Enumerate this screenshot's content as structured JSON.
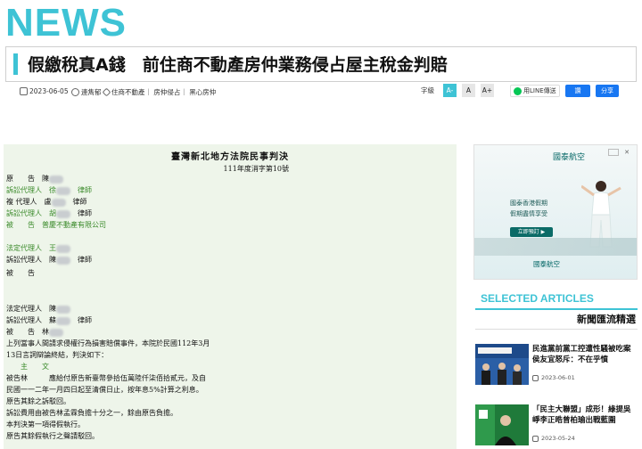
{
  "logo": "NEWS",
  "headline": "假繳稅真A錢　前住商不動產房仲業務侵占屋主稅金判賠",
  "meta": {
    "date": "2023-06-05",
    "author": "連雋郁",
    "tags": "住商不動產｜ 房仲侵占｜ 黑心房仲"
  },
  "font_control": {
    "label": "字級",
    "sizes": [
      "A-",
      "A",
      "A+"
    ]
  },
  "share": {
    "line": "用LINE傳送",
    "like": "讚",
    "fb": "分享"
  },
  "document": {
    "title": "臺灣新北地方法院民事判決",
    "case_no": "111年度消字第10號",
    "lines": [
      [
        "原　　告　陳",
        "",
        ""
      ],
      [
        "訴訟代理人　徐",
        "",
        "　律師"
      ],
      [
        "複 代理人　盧",
        "",
        "　律師"
      ],
      [
        "訴訟代理人　胡",
        "",
        "　律師"
      ],
      [
        "被　　告　普慶不動產有限公司",
        "",
        ""
      ],
      [
        "法定代理人　王",
        "",
        ""
      ],
      [
        "訴訟代理人　陳",
        "",
        "　律師"
      ],
      [
        "被　　告",
        "",
        ""
      ],
      [
        "法定代理人　陳",
        "",
        ""
      ],
      [
        "訴訟代理人　蘇",
        "",
        "　律師"
      ],
      [
        "被　　告　林",
        "",
        ""
      ]
    ],
    "body": [
      "上列當事人間請求侵權行為損害賠償事件，本院於民國112年3月",
      "13日言詞辯論終結，判決如下：",
      "　　主　　文",
      "被告林　　　應給付原告新臺幣參拾伍萬陸仟柒佰拾貳元，及自",
      "民國一一二年一月四日起至清償日止，按年息5%計算之利息。",
      "原告其餘之訴駁回。",
      "訴訟費用由被告林孟霖負擔十分之一，餘由原告負擔。",
      "本判決第一項得假執行。",
      "原告其餘假執行之聲請駁回。"
    ]
  },
  "ad": {
    "top_logo": "國泰航空",
    "line1": "國泰香港假期",
    "line2": "假期盡情享受",
    "button": "立即預訂 ▶",
    "brand": "國泰航空"
  },
  "selected": {
    "title": "SELECTED ARTICLES",
    "subtitle": "新聞匯流精選",
    "articles": [
      {
        "title": "民進黨前黨工控遭性騷被吃案 侯友宜怒斥：不在乎憤",
        "date": "2023-06-01"
      },
      {
        "title": "「民主大聯盟」成形！綠提吳崢李正晧曾柏瑜出戰藍圍",
        "date": "2023-05-24"
      }
    ]
  },
  "colors": {
    "accent": "#3ec3d5",
    "doc_bg": "#eef5ea",
    "doc_highlight": "#3a8a2a"
  }
}
